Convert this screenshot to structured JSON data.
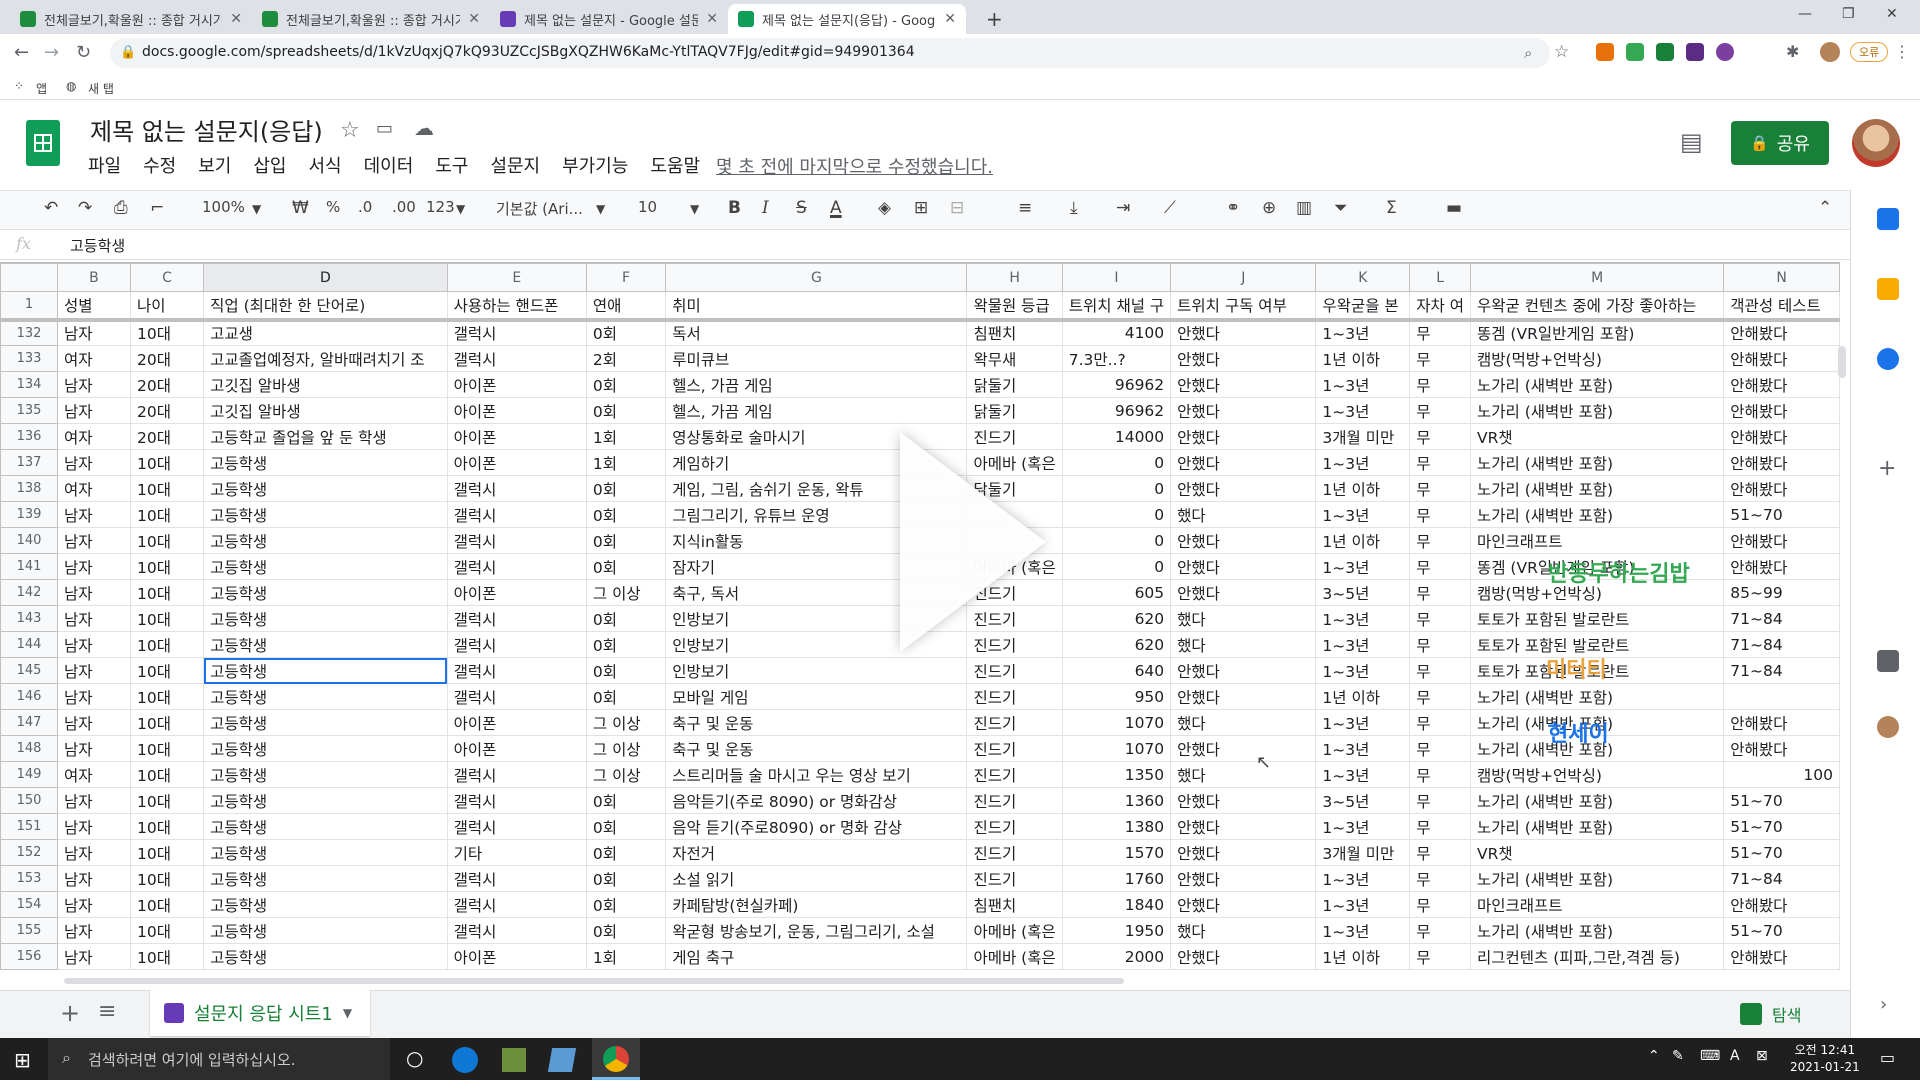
{
  "browser": {
    "tabs": [
      {
        "title": "전체글보기,확울원 :: 종합 거시기",
        "color": "#1e8e3e"
      },
      {
        "title": "전체글보기,확울원 :: 종합 거시기",
        "color": "#1e8e3e"
      },
      {
        "title": "제목 없는 설문지 - Google 설문지",
        "color": "#673ab7"
      },
      {
        "title": "제목 없는 설문지(응답) - Google 시트",
        "color": "#0f9d58"
      }
    ],
    "new_tab": "+",
    "url": "docs.google.com/spreadsheets/d/1kVzUqxjQ7kQ93UZCcJSBgXQZHW6KaMc-YtlTAQV7FJg/edit#gid=949901364",
    "bookmarks": [
      "앱",
      "새 탭"
    ],
    "profile_label": "오류"
  },
  "doc": {
    "title": "제목 없는 설문지(응답)",
    "menus": [
      "파일",
      "수정",
      "보기",
      "삽입",
      "서식",
      "데이터",
      "도구",
      "설문지",
      "부가기능",
      "도움말"
    ],
    "last_edit": "몇 초 전에 마지막으로 수정했습니다.",
    "share_label": "공유"
  },
  "format_toolbar": {
    "zoom": "100%",
    "currency": "₩",
    "percent": "%",
    "decimal_less": ".0",
    "decimal_more": ".00",
    "number_format": "123",
    "font": "기본값 (Ari...",
    "font_size": "10",
    "bold": "B",
    "italic": "I",
    "strike": "S",
    "text_color": "A"
  },
  "formula_bar": {
    "fx": "fx",
    "value": "고등학생"
  },
  "grid": {
    "columns": [
      "B",
      "C",
      "D",
      "E",
      "F",
      "G",
      "H",
      "I",
      "J",
      "K",
      "L",
      "M",
      "N"
    ],
    "selected_column": "D",
    "header_row_number": "1",
    "headers": [
      "성별",
      "나이",
      "직업 (최대한 한 단어로)",
      "사용하는 핸드폰",
      "연애",
      "취미",
      "왁물원 등급",
      "트위치 채널 구",
      "트위치 구독 여부",
      "우왁굳을 본",
      "자차 여",
      "우왁굳 컨텐츠 중에 가장 좋아하는",
      "객관성 테스트"
    ],
    "numeric_columns": [
      7
    ],
    "rows": [
      {
        "n": "132",
        "c": [
          "남자",
          "10대",
          "고교생",
          "갤럭시",
          "0회",
          "독서",
          "침팬치",
          "4100",
          "안했다",
          "1~3년",
          "무",
          "똥겜 (VR일반게임 포함)",
          "안해봤다"
        ]
      },
      {
        "n": "133",
        "c": [
          "여자",
          "20대",
          "고교졸업예정자, 알바때려치기 조",
          "갤럭시",
          "2회",
          "루미큐브",
          "왁무새",
          "7.3만..?",
          "안했다",
          "1년 이하",
          "무",
          "캠방(먹방+언박싱)",
          "안해봤다"
        ]
      },
      {
        "n": "134",
        "c": [
          "남자",
          "20대",
          "고깃집 알바생",
          "아이폰",
          "0회",
          "헬스, 가끔 게임",
          "닭둘기",
          "96962",
          "안했다",
          "1~3년",
          "무",
          "노가리 (새벽반 포함)",
          "안해봤다"
        ]
      },
      {
        "n": "135",
        "c": [
          "남자",
          "20대",
          "고깃집 알바생",
          "아이폰",
          "0회",
          "헬스, 가끔 게임",
          "닭둘기",
          "96962",
          "안했다",
          "1~3년",
          "무",
          "노가리 (새벽반 포함)",
          "안해봤다"
        ]
      },
      {
        "n": "136",
        "c": [
          "여자",
          "20대",
          "고등학교 졸업을 앞 둔 학생",
          "아이폰",
          "1회",
          "영상통화로 술마시기",
          "진드기",
          "14000",
          "안했다",
          "3개월 미만",
          "무",
          "VR챗",
          "안해봤다"
        ]
      },
      {
        "n": "137",
        "c": [
          "남자",
          "10대",
          "고등학생",
          "아이폰",
          "1회",
          "게임하기",
          "아메바 (혹은",
          "0",
          "안했다",
          "1~3년",
          "무",
          "노가리 (새벽반 포함)",
          "안해봤다"
        ]
      },
      {
        "n": "138",
        "c": [
          "여자",
          "10대",
          "고등학생",
          "갤럭시",
          "0회",
          "게임, 그림, 숨쉬기 운동, 왁튜",
          "닭둘기",
          "0",
          "안했다",
          "1년 이하",
          "무",
          "노가리 (새벽반 포함)",
          "안해봤다"
        ]
      },
      {
        "n": "139",
        "c": [
          "남자",
          "10대",
          "고등학생",
          "갤럭시",
          "0회",
          "그림그리기, 유튜브 운영",
          "",
          "0",
          "했다",
          "1~3년",
          "무",
          "노가리 (새벽반 포함)",
          "51~70"
        ]
      },
      {
        "n": "140",
        "c": [
          "남자",
          "10대",
          "고등학생",
          "갤럭시",
          "0회",
          "지식in활동",
          "",
          "0",
          "안했다",
          "1년 이하",
          "무",
          "마인크래프트",
          "안해봤다"
        ]
      },
      {
        "n": "141",
        "c": [
          "남자",
          "10대",
          "고등학생",
          "갤럭시",
          "0회",
          "잠자기",
          "아메바 (혹은",
          "0",
          "안했다",
          "1~3년",
          "무",
          "똥겜 (VR일반게임 포함)",
          "안해봤다"
        ]
      },
      {
        "n": "142",
        "c": [
          "남자",
          "10대",
          "고등학생",
          "아이폰",
          "그 이상",
          "축구, 독서",
          "진드기",
          "605",
          "안했다",
          "3~5년",
          "무",
          "캠방(먹방+언박싱)",
          "85~99"
        ]
      },
      {
        "n": "143",
        "c": [
          "남자",
          "10대",
          "고등학생",
          "갤럭시",
          "0회",
          "인방보기",
          "진드기",
          "620",
          "했다",
          "1~3년",
          "무",
          "토토가 포함된 발로란트",
          "71~84"
        ]
      },
      {
        "n": "144",
        "c": [
          "남자",
          "10대",
          "고등학생",
          "갤럭시",
          "0회",
          "인방보기",
          "진드기",
          "620",
          "했다",
          "1~3년",
          "무",
          "토토가 포함된 발로란트",
          "71~84"
        ]
      },
      {
        "n": "145",
        "c": [
          "남자",
          "10대",
          "고등학생",
          "갤럭시",
          "0회",
          "인방보기",
          "진드기",
          "640",
          "안했다",
          "1~3년",
          "무",
          "토토가 포함된 발로란트",
          "71~84"
        ]
      },
      {
        "n": "146",
        "c": [
          "남자",
          "10대",
          "고등학생",
          "갤럭시",
          "0회",
          "모바일 게임",
          "진드기",
          "950",
          "안했다",
          "1년 이하",
          "무",
          "노가리 (새벽반 포함)",
          ""
        ]
      },
      {
        "n": "147",
        "c": [
          "남자",
          "10대",
          "고등학생",
          "아이폰",
          "그 이상",
          "축구 및 운동",
          "진드기",
          "1070",
          "했다",
          "1~3년",
          "무",
          "노가리 (새벽반 포함)",
          "안해봤다"
        ]
      },
      {
        "n": "148",
        "c": [
          "남자",
          "10대",
          "고등학생",
          "아이폰",
          "그 이상",
          "축구 및 운동",
          "진드기",
          "1070",
          "안했다",
          "1~3년",
          "무",
          "노가리 (새벽반 포함)",
          "안해봤다"
        ]
      },
      {
        "n": "149",
        "c": [
          "여자",
          "10대",
          "고등학생",
          "갤럭시",
          "그 이상",
          "스트리머들 술 마시고 우는 영상 보기",
          "진드기",
          "1350",
          "했다",
          "1~3년",
          "무",
          "캠방(먹방+언박싱)",
          "100"
        ]
      },
      {
        "n": "150",
        "c": [
          "남자",
          "10대",
          "고등학생",
          "갤럭시",
          "0회",
          "음악듣기(주로 8090) or 명화감상",
          "진드기",
          "1360",
          "안했다",
          "3~5년",
          "무",
          "노가리 (새벽반 포함)",
          "51~70"
        ]
      },
      {
        "n": "151",
        "c": [
          "남자",
          "10대",
          "고등학생",
          "갤럭시",
          "0회",
          "음악 듣기(주로8090) or 명화 감상",
          "진드기",
          "1380",
          "안했다",
          "1~3년",
          "무",
          "노가리 (새벽반 포함)",
          "51~70"
        ]
      },
      {
        "n": "152",
        "c": [
          "남자",
          "10대",
          "고등학생",
          "기타",
          "0회",
          "자전거",
          "진드기",
          "1570",
          "안했다",
          "3개월 미만",
          "무",
          "VR챗",
          "51~70"
        ]
      },
      {
        "n": "153",
        "c": [
          "남자",
          "10대",
          "고등학생",
          "갤럭시",
          "0회",
          "소설 읽기",
          "진드기",
          "1760",
          "안했다",
          "1~3년",
          "무",
          "노가리 (새벽반 포함)",
          "71~84"
        ]
      },
      {
        "n": "154",
        "c": [
          "남자",
          "10대",
          "고등학생",
          "갤럭시",
          "0회",
          "카페탐방(현실카페)",
          "침팬치",
          "1840",
          "안했다",
          "1~3년",
          "무",
          "마인크래프트",
          "안해봤다"
        ]
      },
      {
        "n": "155",
        "c": [
          "남자",
          "10대",
          "고등학생",
          "갤럭시",
          "0회",
          "왁굳형 방송보기, 운동, 그림그리기, 소설",
          "아메바 (혹은",
          "1950",
          "했다",
          "1~3년",
          "무",
          "노가리 (새벽반 포함)",
          "51~70"
        ]
      },
      {
        "n": "156",
        "c": [
          "남자",
          "10대",
          "고등학생",
          "아이폰",
          "1회",
          "게임 축구",
          "아메바 (혹은",
          "2000",
          "안했다",
          "1년 이하",
          "무",
          "리그컨텐츠 (피파,그란,격겜 등)",
          "안해봤다"
        ]
      }
    ]
  },
  "sheet_bar": {
    "add": "+",
    "list": "≡",
    "sheet_name": "설문지 응답 시트1",
    "explore": "탐색"
  },
  "taskbar": {
    "search_placeholder": "검색하려면 여기에 입력하십시오.",
    "time": "오전 12:41",
    "date": "2021-01-21"
  },
  "overlay": {
    "texts": [
      "반동무하는김밥",
      "미터티",
      "현세이"
    ]
  }
}
